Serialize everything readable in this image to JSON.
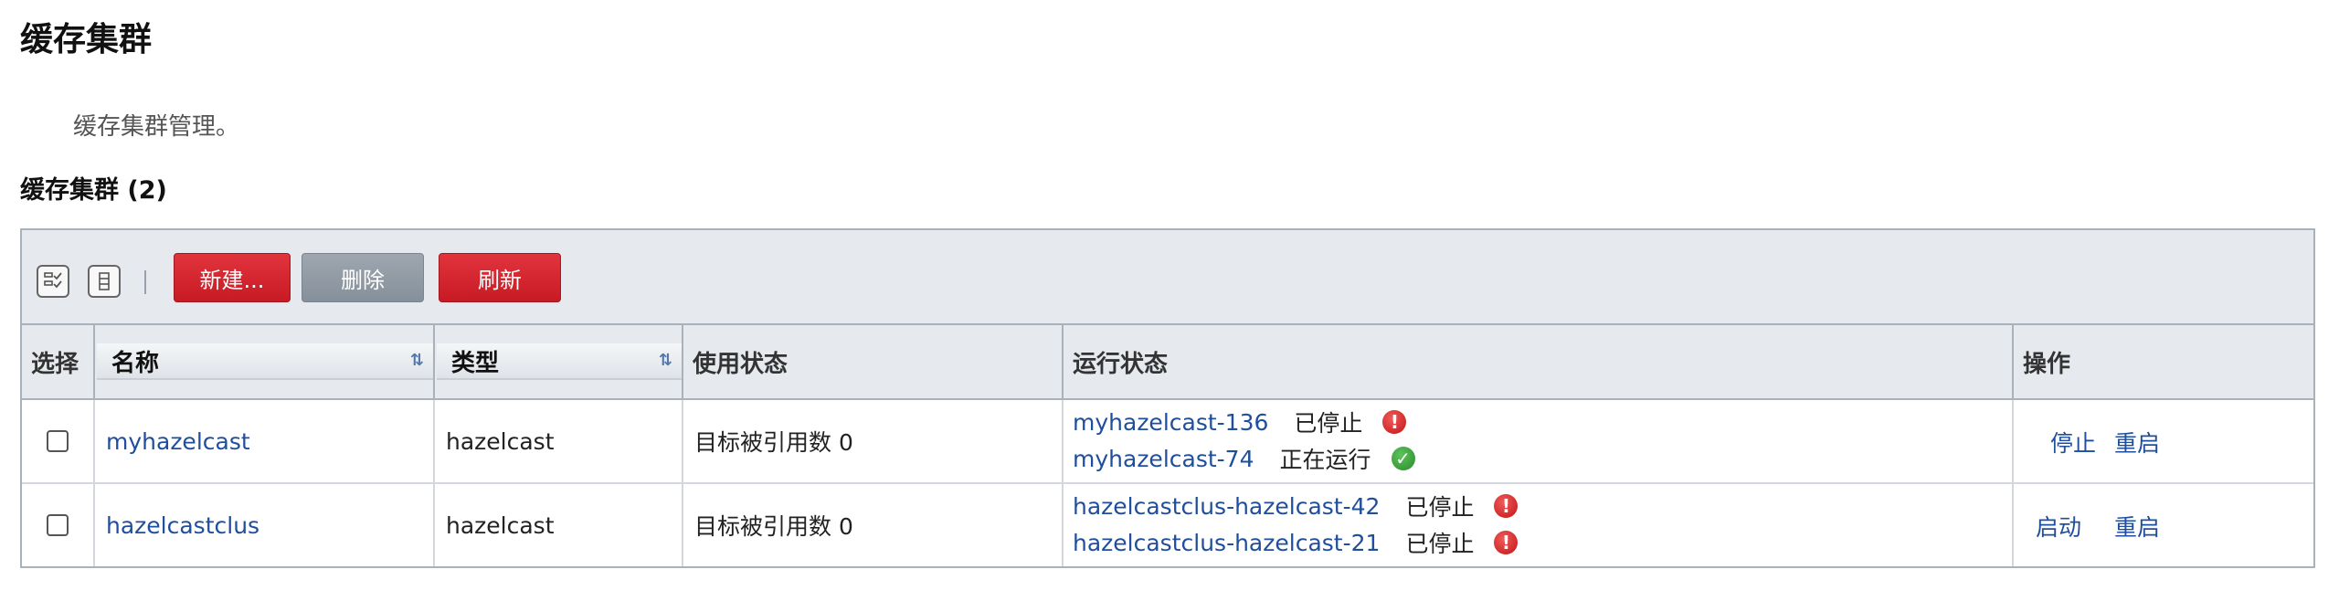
{
  "page": {
    "title": "缓存集群",
    "description": "缓存集群管理。",
    "section_title": "缓存集群 (2)"
  },
  "toolbar": {
    "select_all_icon": "checklist-icon",
    "columns_icon": "columns-icon",
    "new_label": "新建...",
    "delete_label": "删除",
    "refresh_label": "刷新"
  },
  "table": {
    "headers": {
      "select": "选择",
      "name": "名称",
      "type": "类型",
      "usage": "使用状态",
      "run_status": "运行状态",
      "actions": "操作"
    },
    "rows": [
      {
        "name": "myhazelcast",
        "type": "hazelcast",
        "usage": "目标被引用数 0",
        "instances": [
          {
            "name": "myhazelcast-136",
            "status": "已停止",
            "state_icon": "error-icon"
          },
          {
            "name": "myhazelcast-74",
            "status": "正在运行",
            "state_icon": "ok-icon"
          }
        ],
        "actions": {
          "primary": "停止",
          "restart": "重启"
        }
      },
      {
        "name": "hazelcastclus",
        "type": "hazelcast",
        "usage": "目标被引用数 0",
        "instances": [
          {
            "name": "hazelcastclus-hazelcast-42",
            "status": "已停止",
            "state_icon": "error-icon"
          },
          {
            "name": "hazelcastclus-hazelcast-21",
            "status": "已停止",
            "state_icon": "error-icon"
          }
        ],
        "actions": {
          "primary": "启动",
          "restart": "重启"
        }
      }
    ]
  },
  "colors": {
    "accent_red": "#d0202a",
    "link_blue": "#1f4e9c",
    "header_bg": "#e6e9ee"
  }
}
